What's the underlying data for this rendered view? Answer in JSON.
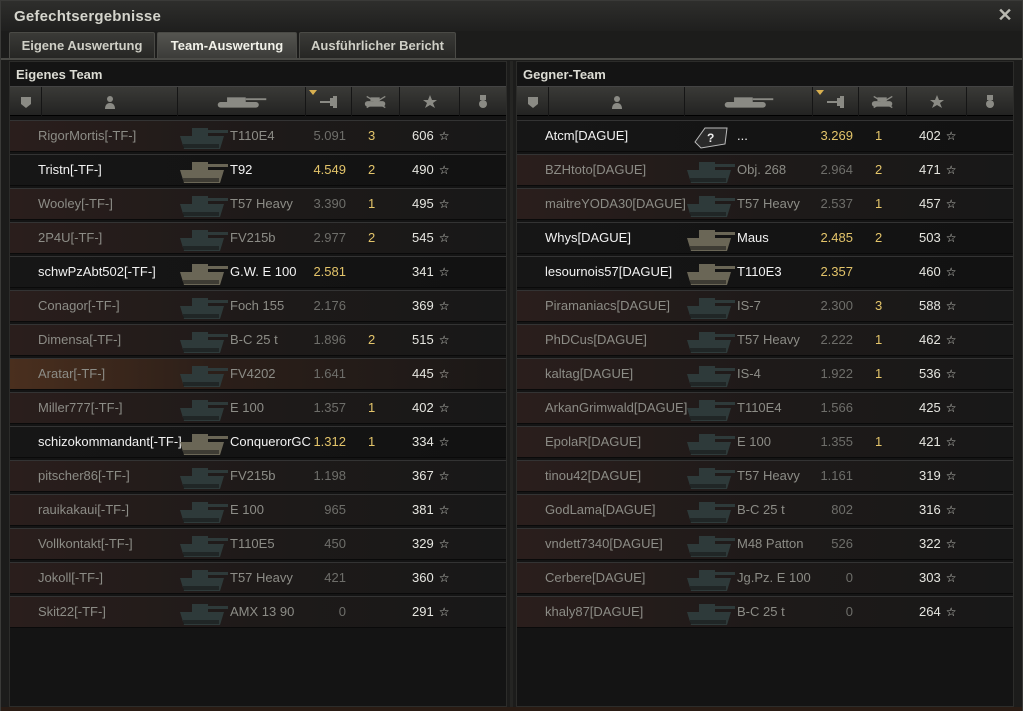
{
  "window": {
    "title": "Gefechtsergebnisse"
  },
  "tabs": [
    {
      "label": "Eigene Auswertung",
      "active": false
    },
    {
      "label": "Team-Auswertung",
      "active": true
    },
    {
      "label": "Ausführlicher Bericht",
      "active": false
    }
  ],
  "own_team": {
    "title": "Eigenes Team",
    "rows": [
      {
        "name": "RigorMortis[-TF-]",
        "tank": "T110E4",
        "rating": "5.091",
        "kills": "3",
        "xp": "606",
        "alive": false
      },
      {
        "name": "Tristn[-TF-]",
        "tank": "T92",
        "rating": "4.549",
        "kills": "2",
        "xp": "490",
        "alive": true
      },
      {
        "name": "Wooley[-TF-]",
        "tank": "T57 Heavy",
        "rating": "3.390",
        "kills": "1",
        "xp": "495",
        "alive": false
      },
      {
        "name": "2P4U[-TF-]",
        "tank": "FV215b",
        "rating": "2.977",
        "kills": "2",
        "xp": "545",
        "alive": false
      },
      {
        "name": "schwPzAbt502[-TF-]",
        "tank": "G.W. E 100",
        "rating": "2.581",
        "kills": "",
        "xp": "341",
        "alive": true
      },
      {
        "name": "Conagor[-TF-]",
        "tank": "Foch 155",
        "rating": "2.176",
        "kills": "",
        "xp": "369",
        "alive": false
      },
      {
        "name": "Dimensa[-TF-]",
        "tank": "B-C 25 t",
        "rating": "1.896",
        "kills": "2",
        "xp": "515",
        "alive": false
      },
      {
        "name": "Aratar[-TF-]",
        "tank": "FV4202",
        "rating": "1.641",
        "kills": "",
        "xp": "445",
        "alive": false,
        "highlight": true
      },
      {
        "name": "Miller777[-TF-]",
        "tank": "E 100",
        "rating": "1.357",
        "kills": "1",
        "xp": "402",
        "alive": false
      },
      {
        "name": "schizokommandant[-TF-]",
        "tank": "ConquerorGC",
        "rating": "1.312",
        "kills": "1",
        "xp": "334",
        "alive": true
      },
      {
        "name": "pitscher86[-TF-]",
        "tank": "FV215b",
        "rating": "1.198",
        "kills": "",
        "xp": "367",
        "alive": false
      },
      {
        "name": "rauikakaui[-TF-]",
        "tank": "E 100",
        "rating": "965",
        "kills": "",
        "xp": "381",
        "alive": false
      },
      {
        "name": "Vollkontakt[-TF-]",
        "tank": "T110E5",
        "rating": "450",
        "kills": "",
        "xp": "329",
        "alive": false
      },
      {
        "name": "Jokoll[-TF-]",
        "tank": "T57 Heavy",
        "rating": "421",
        "kills": "",
        "xp": "360",
        "alive": false
      },
      {
        "name": "Skit22[-TF-]",
        "tank": "AMX 13 90",
        "rating": "0",
        "kills": "",
        "xp": "291",
        "alive": false
      }
    ]
  },
  "enemy_team": {
    "title": "Gegner-Team",
    "rows": [
      {
        "name": "Atcm[DAGUE]",
        "tank": "...",
        "rating": "3.269",
        "kills": "1",
        "xp": "402",
        "alive": true,
        "unknown": true
      },
      {
        "name": "BZHtoto[DAGUE]",
        "tank": "Obj. 268",
        "rating": "2.964",
        "kills": "2",
        "xp": "471",
        "alive": false
      },
      {
        "name": "maitreYODA30[DAGUE]",
        "tank": "T57 Heavy",
        "rating": "2.537",
        "kills": "1",
        "xp": "457",
        "alive": false
      },
      {
        "name": "Whys[DAGUE]",
        "tank": "Maus",
        "rating": "2.485",
        "kills": "2",
        "xp": "503",
        "alive": true
      },
      {
        "name": "lesournois57[DAGUE]",
        "tank": "T110E3",
        "rating": "2.357",
        "kills": "",
        "xp": "460",
        "alive": true
      },
      {
        "name": "Piramaniacs[DAGUE]",
        "tank": "IS-7",
        "rating": "2.300",
        "kills": "3",
        "xp": "588",
        "alive": false
      },
      {
        "name": "PhDCus[DAGUE]",
        "tank": "T57 Heavy",
        "rating": "2.222",
        "kills": "1",
        "xp": "462",
        "alive": false
      },
      {
        "name": "kaltag[DAGUE]",
        "tank": "IS-4",
        "rating": "1.922",
        "kills": "1",
        "xp": "536",
        "alive": false
      },
      {
        "name": "ArkanGrimwald[DAGUE]",
        "tank": "T110E4",
        "rating": "1.566",
        "kills": "",
        "xp": "425",
        "alive": false
      },
      {
        "name": "EpolaR[DAGUE]",
        "tank": "E 100",
        "rating": "1.355",
        "kills": "1",
        "xp": "421",
        "alive": false
      },
      {
        "name": "tinou42[DAGUE]",
        "tank": "T57 Heavy",
        "rating": "1.161",
        "kills": "",
        "xp": "319",
        "alive": false
      },
      {
        "name": "GodLama[DAGUE]",
        "tank": "B-C 25 t",
        "rating": "802",
        "kills": "",
        "xp": "316",
        "alive": false
      },
      {
        "name": "vndett7340[DAGUE]",
        "tank": "M48 Patton",
        "rating": "526",
        "kills": "",
        "xp": "322",
        "alive": false
      },
      {
        "name": "Cerbere[DAGUE]",
        "tank": "Jg.Pz. E 100",
        "rating": "0",
        "kills": "",
        "xp": "303",
        "alive": false
      },
      {
        "name": "khaly87[DAGUE]",
        "tank": "B-C 25 t",
        "rating": "0",
        "kills": "",
        "xp": "264",
        "alive": false
      }
    ]
  },
  "icons": {
    "close": "close-icon",
    "squad": "squad-icon",
    "player": "player-icon",
    "tank": "tank-icon",
    "damage": "damage-icon",
    "kills": "destroyed-tank-icon",
    "xp": "xp-star-icon",
    "medal": "medal-icon"
  },
  "colors": {
    "accent": "#e3c46a",
    "alive_text": "#f2f2f2",
    "dead_text": "#8c8c86"
  }
}
